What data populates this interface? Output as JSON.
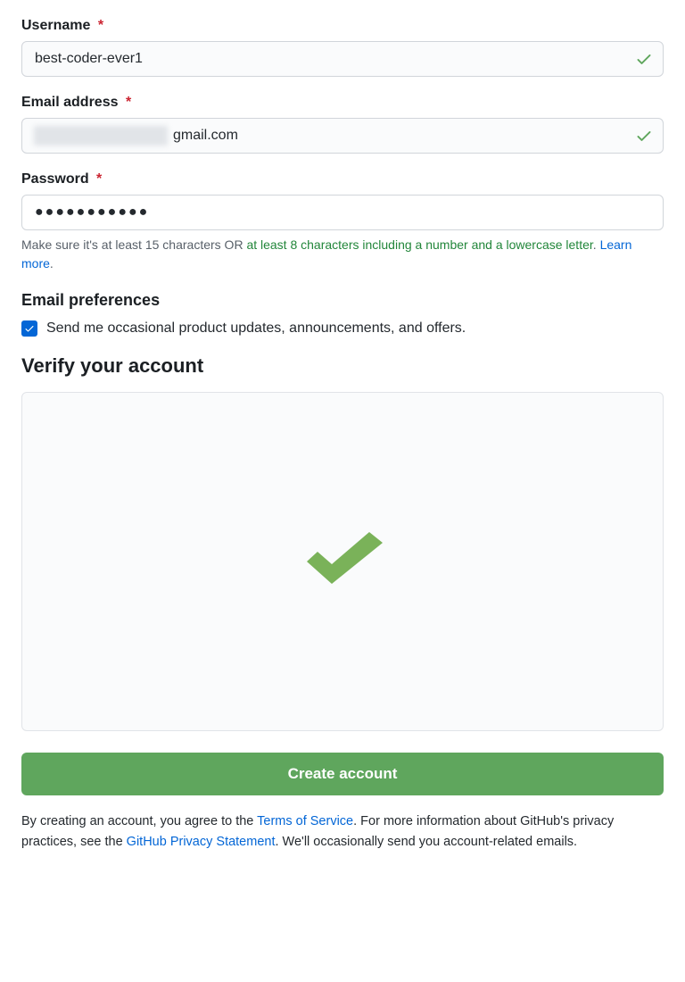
{
  "labels": {
    "username": "Username",
    "email": "Email address",
    "password": "Password",
    "emailPrefs": "Email preferences",
    "verify": "Verify your account",
    "required": "*"
  },
  "values": {
    "username": "best-coder-ever1",
    "emailSuffix": "gmail.com",
    "passwordMasked": "●●●●●●●●●●●"
  },
  "passwordHelp": {
    "prefix": "Make sure it's at least 15 characters OR ",
    "greenPart": "at least 8 characters including a number and a lowercase letter",
    "afterGreen": ". ",
    "learnMore": "Learn more",
    "period": "."
  },
  "checkbox": {
    "label": "Send me occasional product updates, announcements, and offers."
  },
  "button": {
    "create": "Create account"
  },
  "terms": {
    "t1": "By creating an account, you agree to the ",
    "link1": "Terms of Service",
    "t2": ". For more information about GitHub's privacy practices, see the ",
    "link2": "GitHub Privacy Statement",
    "t3": ". We'll occasionally send you account-related emails."
  }
}
